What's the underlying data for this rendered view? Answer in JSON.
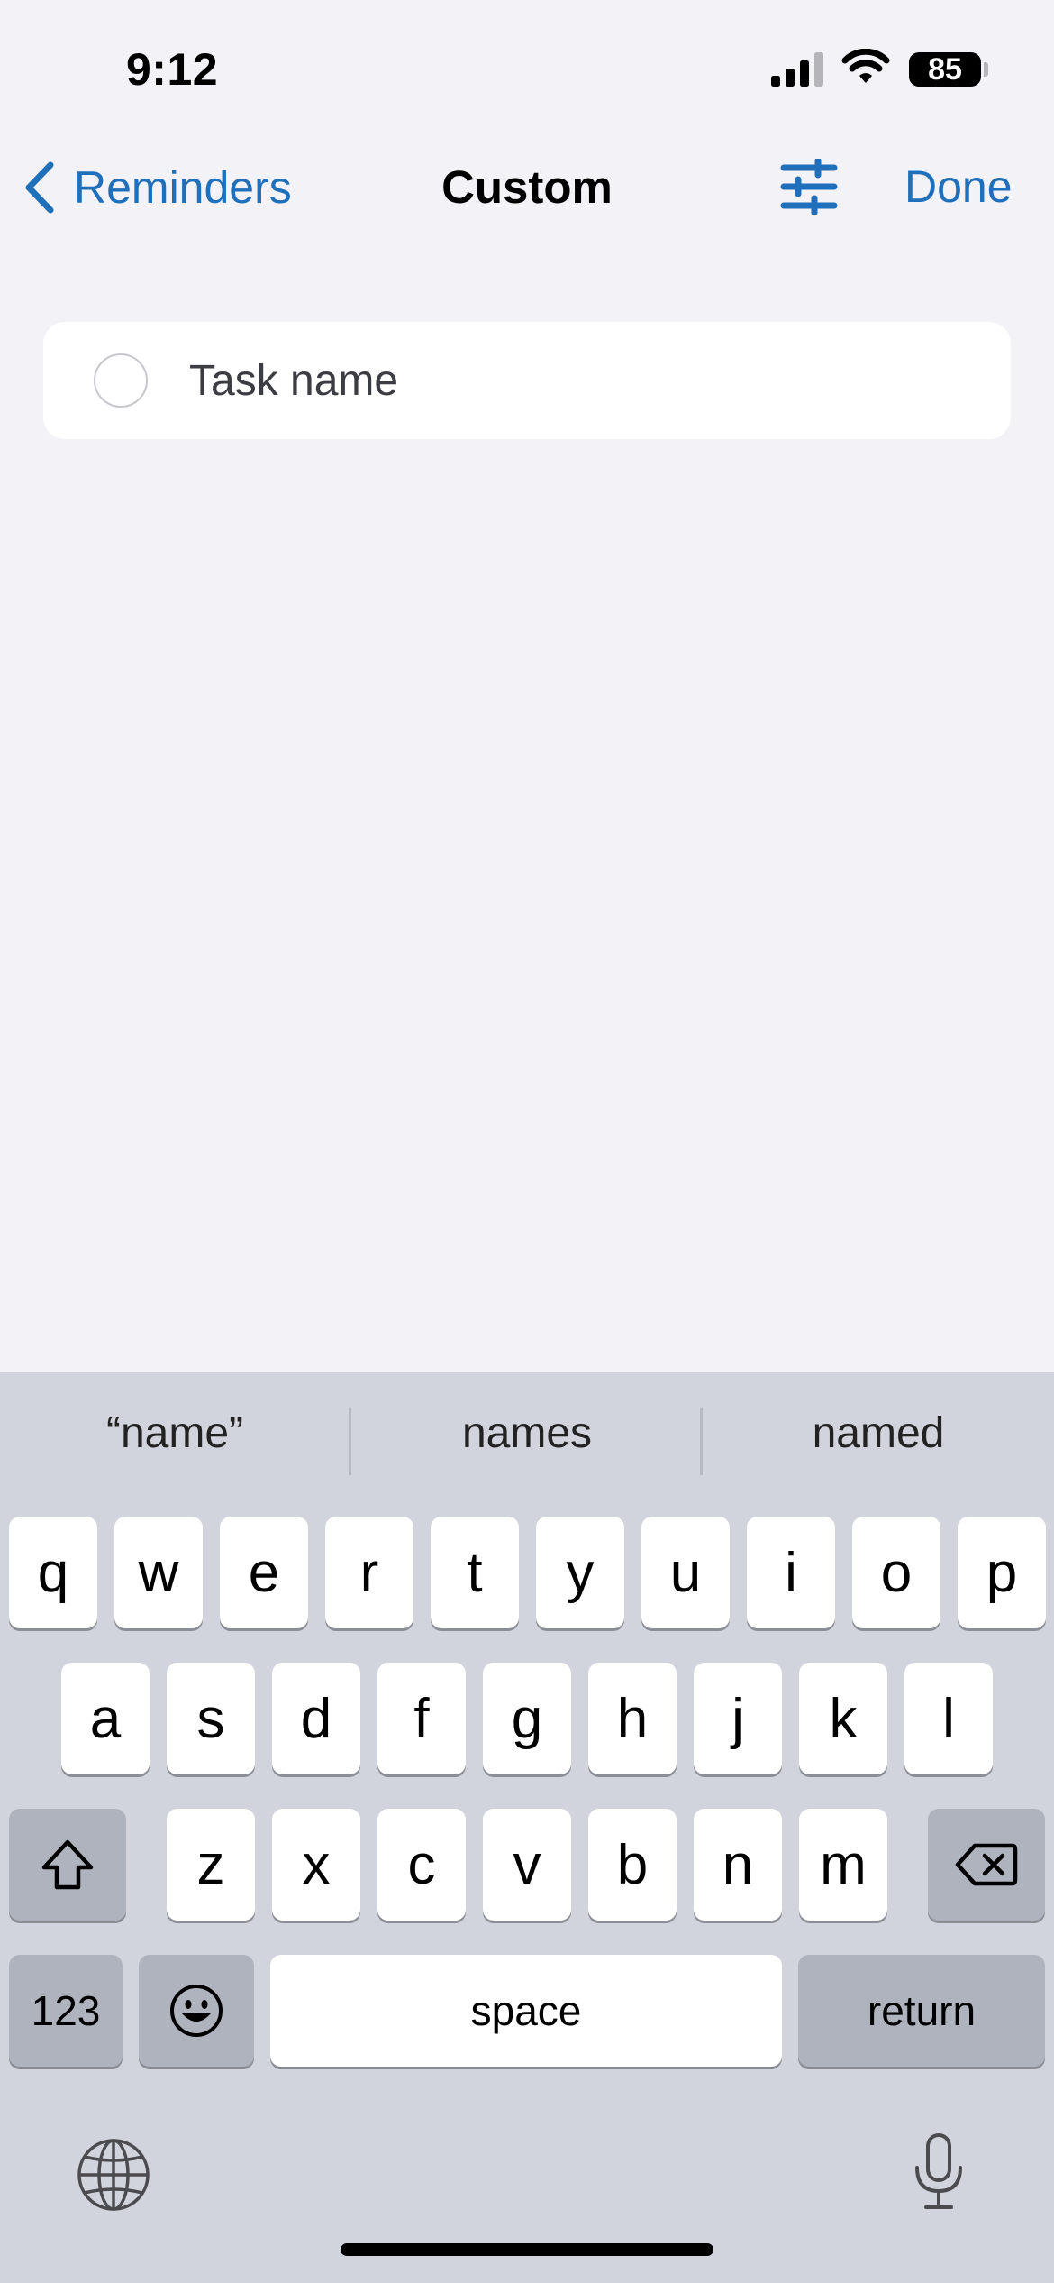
{
  "status_bar": {
    "time": "9:12",
    "battery": "85",
    "icons": [
      "cellular-signal-icon",
      "wifi-icon",
      "battery-icon"
    ]
  },
  "nav": {
    "back_label": "Reminders",
    "title": "Custom",
    "done_label": "Done",
    "filter_icon": "sliders-icon",
    "accent_color": "#1f6fba"
  },
  "task": {
    "placeholder": "Task name",
    "value": ""
  },
  "keyboard": {
    "suggestions": [
      "“name”",
      "names",
      "named"
    ],
    "row1": [
      "q",
      "w",
      "e",
      "r",
      "t",
      "y",
      "u",
      "i",
      "o",
      "p"
    ],
    "row2": [
      "a",
      "s",
      "d",
      "f",
      "g",
      "h",
      "j",
      "k",
      "l"
    ],
    "row3": [
      "z",
      "x",
      "c",
      "v",
      "b",
      "n",
      "m"
    ],
    "numbers_label": "123",
    "space_label": "space",
    "return_label": "return",
    "icons": [
      "shift-icon",
      "delete-icon",
      "emoji-icon",
      "globe-icon",
      "microphone-icon"
    ]
  }
}
